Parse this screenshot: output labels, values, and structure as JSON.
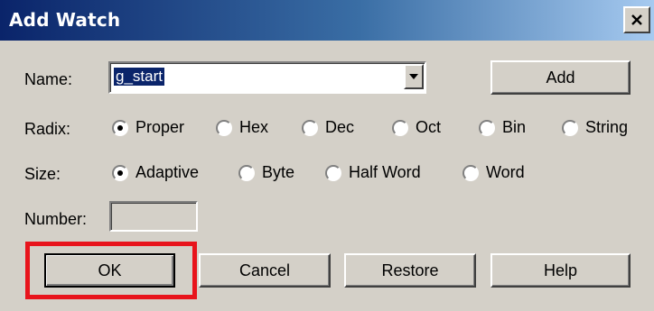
{
  "window": {
    "title": "Add Watch"
  },
  "labels": {
    "name": "Name:",
    "radix": "Radix:",
    "size": "Size:",
    "number": "Number:"
  },
  "name_combo": {
    "value": "g_start"
  },
  "buttons": {
    "add": "Add",
    "ok": "OK",
    "cancel": "Cancel",
    "restore": "Restore",
    "help": "Help"
  },
  "radix_options": [
    {
      "label": "Proper",
      "checked": true
    },
    {
      "label": "Hex",
      "checked": false
    },
    {
      "label": "Dec",
      "checked": false
    },
    {
      "label": "Oct",
      "checked": false
    },
    {
      "label": "Bin",
      "checked": false
    },
    {
      "label": "String",
      "checked": false
    }
  ],
  "size_options": [
    {
      "label": "Adaptive",
      "checked": true
    },
    {
      "label": "Byte",
      "checked": false
    },
    {
      "label": "Half Word",
      "checked": false
    },
    {
      "label": "Word",
      "checked": false
    }
  ],
  "number_field": {
    "value": ""
  },
  "colors": {
    "titlebar_start": "#0a246a",
    "titlebar_end": "#a6caf0",
    "dialog_bg": "#d4d0c8",
    "highlight": "#e8141c"
  },
  "icons": {
    "close": "close-icon",
    "dropdown": "chevron-down-icon"
  }
}
